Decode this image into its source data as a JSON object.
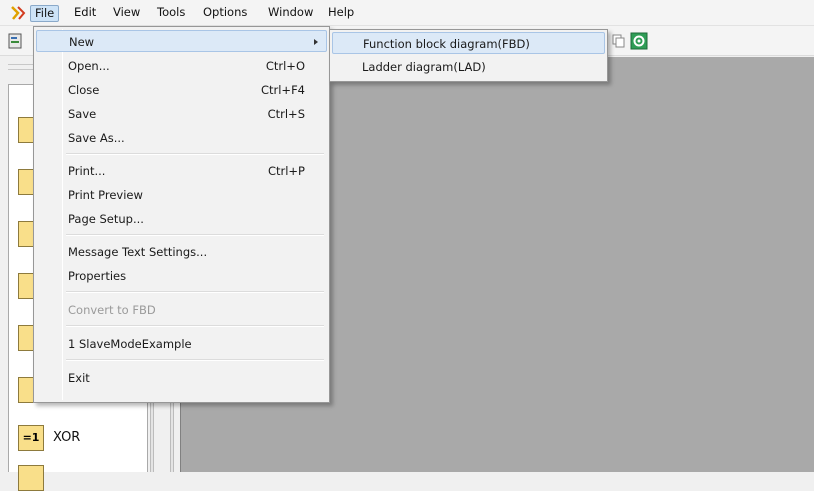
{
  "menubar": {
    "items": [
      {
        "label": "File"
      },
      {
        "label": "Edit"
      },
      {
        "label": "View"
      },
      {
        "label": "Tools"
      },
      {
        "label": "Options"
      },
      {
        "label": "Window"
      },
      {
        "label": "Help"
      }
    ]
  },
  "file_menu": {
    "new": {
      "label": "New"
    },
    "open": {
      "label": "Open...",
      "shortcut": "Ctrl+O"
    },
    "close": {
      "label": "Close",
      "shortcut": "Ctrl+F4"
    },
    "save": {
      "label": "Save",
      "shortcut": "Ctrl+S"
    },
    "save_as": {
      "label": "Save As..."
    },
    "print": {
      "label": "Print...",
      "shortcut": "Ctrl+P"
    },
    "print_preview": {
      "label": "Print Preview"
    },
    "page_setup": {
      "label": "Page Setup..."
    },
    "message_text_settings": {
      "label": "Message Text Settings..."
    },
    "properties": {
      "label": "Properties"
    },
    "convert_to_fbd": {
      "label": "Convert to FBD",
      "enabled": false
    },
    "recent_1": {
      "label": "1 SlaveModeExample"
    },
    "exit": {
      "label": "Exit"
    }
  },
  "new_submenu": {
    "fbd": {
      "label": "Function block diagram(FBD)"
    },
    "lad": {
      "label": "Ladder diagram(LAD)"
    }
  },
  "palette": {
    "xor_block": {
      "symbol": "=1",
      "label": "XOR"
    }
  },
  "colors": {
    "workspace": "#a9a9a9",
    "highlight": "#dce9f7",
    "block_fill": "#f9df8a"
  }
}
